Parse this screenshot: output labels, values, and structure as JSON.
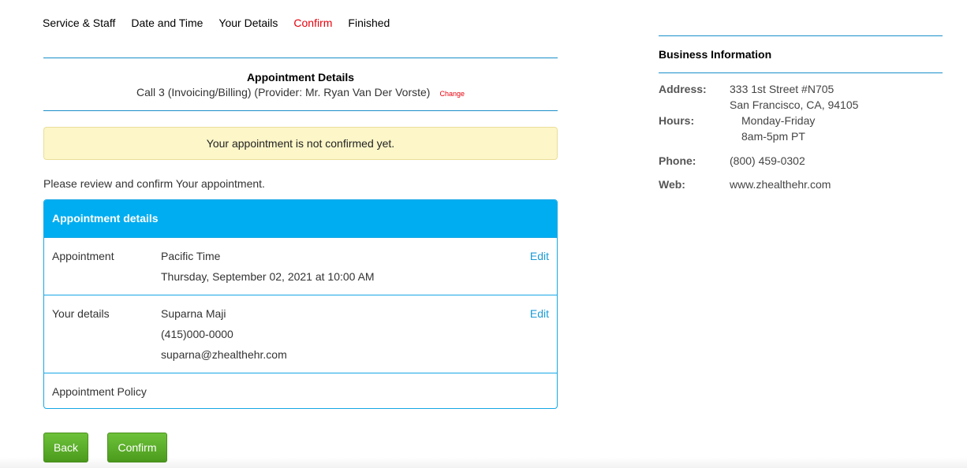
{
  "steps": [
    "Service & Staff",
    "Date and Time",
    "Your Details",
    "Confirm",
    "Finished"
  ],
  "active_step": "Confirm",
  "appointment_header": {
    "title": "Appointment Details",
    "service": "Call 3 (Invoicing/Billing) (Provider: Mr. Ryan Van Der Vorste)",
    "change_label": "Change"
  },
  "alert": "Your appointment is not confirmed yet.",
  "review_text": "Please review and confirm Your appointment.",
  "panel": {
    "title": "Appointment details",
    "appointment": {
      "label": "Appointment",
      "timezone": "Pacific Time",
      "datetime": "Thursday, September 02, 2021 at 10:00 AM",
      "edit_label": "Edit"
    },
    "details": {
      "label": "Your details",
      "name": "Suparna Maji",
      "phone": "(415)000-0000",
      "email": "suparna@zhealthehr.com",
      "edit_label": "Edit"
    },
    "policy_label": "Appointment Policy"
  },
  "buttons": {
    "back": "Back",
    "confirm": "Confirm"
  },
  "business": {
    "title": "Business Information",
    "address_label": "Address:",
    "address_line1": "333 1st Street #N705",
    "address_line2": "San Francisco, CA, 94105",
    "hours_label": "Hours:",
    "hours_line1": "Monday-Friday",
    "hours_line2": "8am-5pm PT",
    "phone_label": "Phone:",
    "phone": "(800) 459-0302",
    "web_label": "Web:",
    "web": "www.zhealthehr.com"
  },
  "colors": {
    "accent": "#00adf0",
    "active_step": "#e8000b",
    "button_green": "#5cb02b",
    "alert_bg": "#fcf6c8"
  }
}
